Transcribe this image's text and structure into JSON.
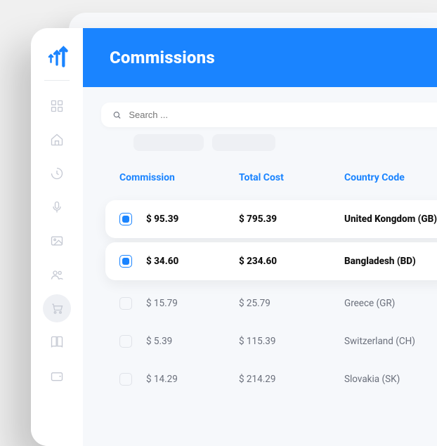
{
  "header": {
    "title": "Commissions"
  },
  "search": {
    "placeholder": "Search ..."
  },
  "table": {
    "headers": {
      "commission": "Commission",
      "total_cost": "Total Cost",
      "country": "Country Code"
    },
    "rows": [
      {
        "selected": true,
        "commission": "$ 95.39",
        "total_cost": "$ 795.39",
        "country": "United Kongdom (GB)"
      },
      {
        "selected": true,
        "commission": "$ 34.60",
        "total_cost": "$ 234.60",
        "country": "Bangladesh (BD)"
      },
      {
        "selected": false,
        "commission": "$ 15.79",
        "total_cost": "$ 25.79",
        "country": "Greece (GR)"
      },
      {
        "selected": false,
        "commission": "$ 5.39",
        "total_cost": "$ 115.39",
        "country": "Switzerland (CH)"
      },
      {
        "selected": false,
        "commission": "$ 14.29",
        "total_cost": "$ 214.29",
        "country": "Slovakia (SK)"
      }
    ]
  },
  "sidebar": {
    "items": [
      {
        "name": "dashboard"
      },
      {
        "name": "home"
      },
      {
        "name": "activity"
      },
      {
        "name": "mic"
      },
      {
        "name": "image"
      },
      {
        "name": "users"
      },
      {
        "name": "cart",
        "active": true
      },
      {
        "name": "book"
      },
      {
        "name": "wallet"
      }
    ]
  }
}
